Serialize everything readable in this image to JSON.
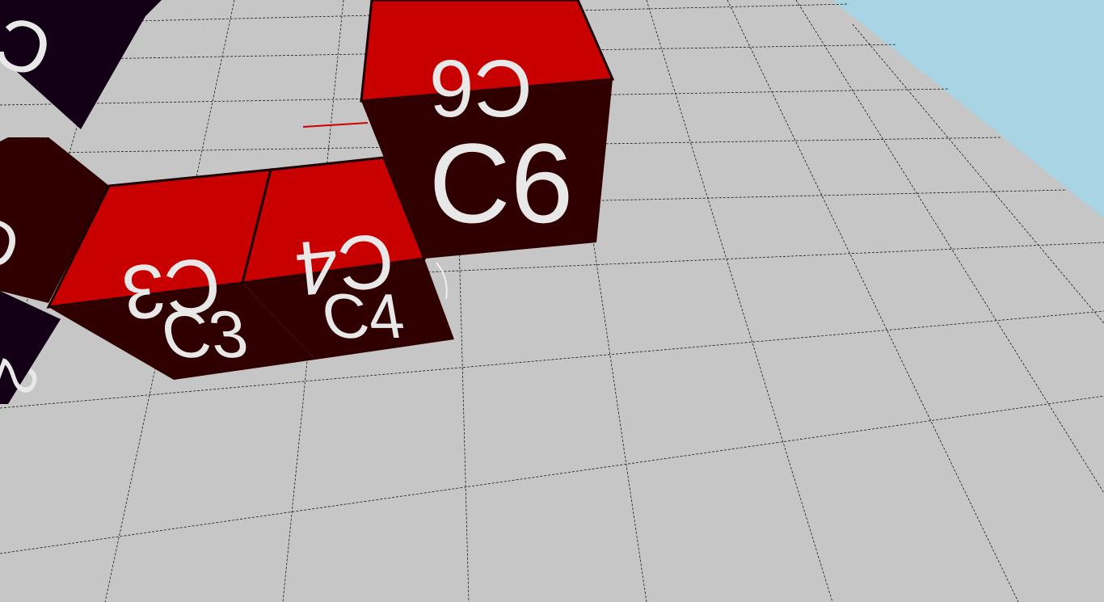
{
  "scene": {
    "floor_color": "#c6c6c6",
    "sky_color": "#a8d4e4",
    "grid_line_color": "#1a1a1a",
    "red_face_color": "#c80000",
    "dark_red_face_color": "#300000",
    "dark_purple_face_color": "#140016",
    "label_color": "#e8e8e8"
  },
  "blocks": {
    "c3": {
      "top_label": "C3",
      "side_label": "C3"
    },
    "c4": {
      "top_label": "C4",
      "side_label": "C4"
    },
    "c6": {
      "top_label": "C6",
      "side_label": "C6"
    }
  }
}
